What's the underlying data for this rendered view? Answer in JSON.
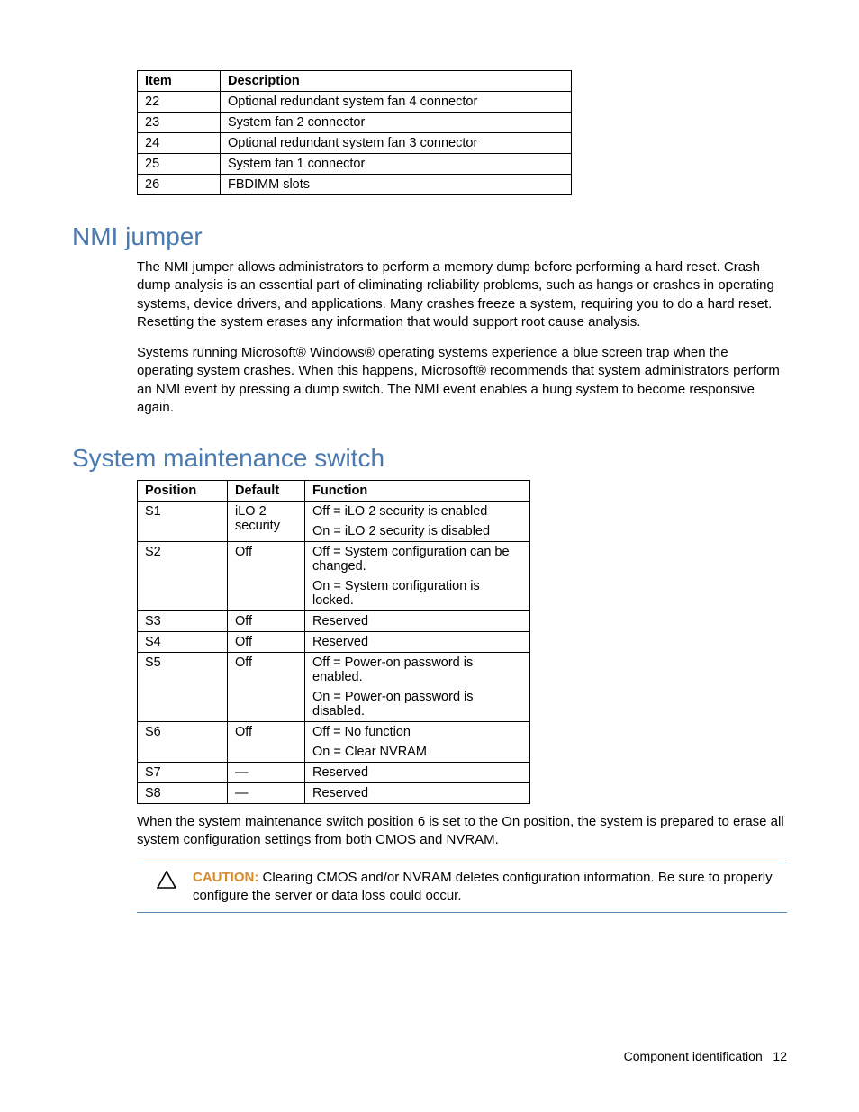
{
  "table1": {
    "headers": [
      "Item",
      "Description"
    ],
    "rows": [
      [
        "22",
        "Optional redundant system fan 4 connector"
      ],
      [
        "23",
        "System fan 2 connector"
      ],
      [
        "24",
        "Optional redundant system fan 3 connector"
      ],
      [
        "25",
        "System fan 1 connector"
      ],
      [
        "26",
        "FBDIMM slots"
      ]
    ]
  },
  "nmi": {
    "heading": "NMI jumper",
    "p1": "The NMI jumper allows administrators to perform a memory dump before performing a hard reset. Crash dump analysis is an essential part of eliminating reliability problems, such as hangs or crashes in operating systems, device drivers, and applications. Many crashes freeze a system, requiring you to do a hard reset. Resetting the system erases any information that would support root cause analysis.",
    "p2": "Systems running Microsoft® Windows® operating systems experience a blue screen trap when the operating system crashes. When this happens, Microsoft® recommends that system administrators perform an NMI event by pressing a dump switch. The NMI event enables a hung system to become responsive again."
  },
  "sms": {
    "heading": "System maintenance switch",
    "headers": [
      "Position",
      "Default",
      "Function"
    ],
    "rows": [
      {
        "pos": "S1",
        "def": "iLO 2 security",
        "func": [
          "Off = iLO 2 security is enabled",
          "On = iLO 2 security is disabled"
        ]
      },
      {
        "pos": "S2",
        "def": "Off",
        "func": [
          "Off = System configuration can be changed.",
          "On = System configuration is locked."
        ]
      },
      {
        "pos": "S3",
        "def": "Off",
        "func": [
          "Reserved"
        ]
      },
      {
        "pos": "S4",
        "def": "Off",
        "func": [
          "Reserved"
        ]
      },
      {
        "pos": "S5",
        "def": "Off",
        "func": [
          "Off = Power-on password is enabled.",
          "On = Power-on password is disabled."
        ]
      },
      {
        "pos": "S6",
        "def": "Off",
        "func": [
          "Off = No function",
          "On = Clear NVRAM"
        ]
      },
      {
        "pos": "S7",
        "def": "—",
        "func": [
          "Reserved"
        ]
      },
      {
        "pos": "S8",
        "def": "—",
        "func": [
          "Reserved"
        ]
      }
    ],
    "after": "When the system maintenance switch position 6 is set to the On position, the system is prepared to erase all system configuration settings from both CMOS and NVRAM."
  },
  "caution": {
    "label": "CAUTION:",
    "text": " Clearing CMOS and/or NVRAM deletes configuration information. Be sure to properly configure the server or data loss could occur."
  },
  "footer": {
    "section": "Component identification",
    "page": "12"
  }
}
